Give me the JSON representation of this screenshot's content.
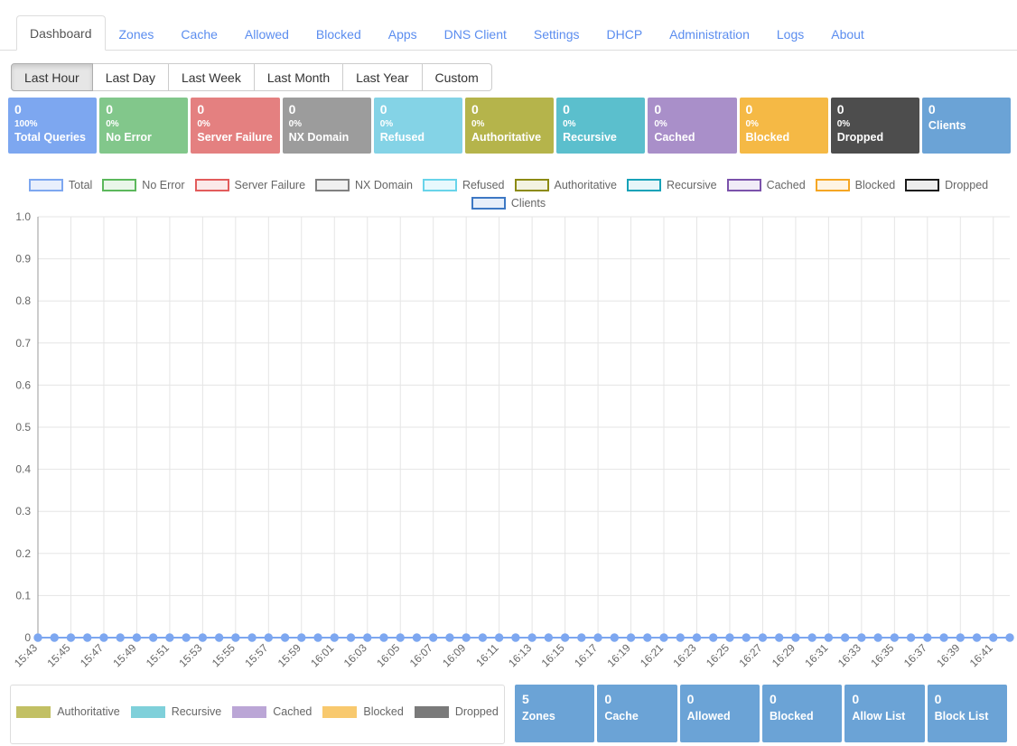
{
  "nav": {
    "tabs": [
      {
        "label": "Dashboard",
        "active": true
      },
      {
        "label": "Zones",
        "active": false
      },
      {
        "label": "Cache",
        "active": false
      },
      {
        "label": "Allowed",
        "active": false
      },
      {
        "label": "Blocked",
        "active": false
      },
      {
        "label": "Apps",
        "active": false
      },
      {
        "label": "DNS Client",
        "active": false
      },
      {
        "label": "Settings",
        "active": false
      },
      {
        "label": "DHCP",
        "active": false
      },
      {
        "label": "Administration",
        "active": false
      },
      {
        "label": "Logs",
        "active": false
      },
      {
        "label": "About",
        "active": false
      }
    ]
  },
  "range_buttons": [
    {
      "label": "Last Hour",
      "active": true
    },
    {
      "label": "Last Day",
      "active": false
    },
    {
      "label": "Last Week",
      "active": false
    },
    {
      "label": "Last Month",
      "active": false
    },
    {
      "label": "Last Year",
      "active": false
    },
    {
      "label": "Custom",
      "active": false
    }
  ],
  "stat_cards": [
    {
      "value": "0",
      "percent": "100%",
      "label": "Total Queries",
      "color": "#7da7f0"
    },
    {
      "value": "0",
      "percent": "0%",
      "label": "No Error",
      "color": "#82c78b"
    },
    {
      "value": "0",
      "percent": "0%",
      "label": "Server Failure",
      "color": "#e48080"
    },
    {
      "value": "0",
      "percent": "0%",
      "label": "NX Domain",
      "color": "#9c9c9c"
    },
    {
      "value": "0",
      "percent": "0%",
      "label": "Refused",
      "color": "#84d3e6"
    },
    {
      "value": "0",
      "percent": "0%",
      "label": "Authoritative",
      "color": "#b5b44b"
    },
    {
      "value": "0",
      "percent": "0%",
      "label": "Recursive",
      "color": "#5bbfcd"
    },
    {
      "value": "0",
      "percent": "0%",
      "label": "Cached",
      "color": "#a98fc9"
    },
    {
      "value": "0",
      "percent": "0%",
      "label": "Blocked",
      "color": "#f5b945"
    },
    {
      "value": "0",
      "percent": "0%",
      "label": "Dropped",
      "color": "#4d4d4d"
    },
    {
      "value": "0",
      "percent": "",
      "label": "Clients",
      "color": "#6ba3d6"
    }
  ],
  "bottom_legend": [
    {
      "label": "Authoritative",
      "color": "#c2c064"
    },
    {
      "label": "Recursive",
      "color": "#7fd0da"
    },
    {
      "label": "Cached",
      "color": "#bba6d6"
    },
    {
      "label": "Blocked",
      "color": "#f8c96e"
    },
    {
      "label": "Dropped",
      "color": "#7a7a7a"
    }
  ],
  "bottom_cards": [
    {
      "value": "5",
      "label": "Zones",
      "color": "#6ba3d6"
    },
    {
      "value": "0",
      "label": "Cache",
      "color": "#6ba3d6"
    },
    {
      "value": "0",
      "label": "Allowed",
      "color": "#6ba3d6"
    },
    {
      "value": "0",
      "label": "Blocked",
      "color": "#6ba3d6"
    },
    {
      "value": "0",
      "label": "Allow List",
      "color": "#6ba3d6"
    },
    {
      "value": "0",
      "label": "Block List",
      "color": "#6ba3d6"
    }
  ],
  "chart_data": {
    "type": "line",
    "title": "",
    "xlabel": "",
    "ylabel": "",
    "ylim": [
      0,
      1.0
    ],
    "y_ticks": [
      "0",
      "0.1",
      "0.2",
      "0.3",
      "0.4",
      "0.5",
      "0.6",
      "0.7",
      "0.8",
      "0.9",
      "1.0"
    ],
    "grid": true,
    "legend_position": "top",
    "x_tick_labels": [
      "15:43",
      "15:45",
      "15:47",
      "15:49",
      "15:51",
      "15:53",
      "15:55",
      "15:57",
      "15:59",
      "16:01",
      "16:03",
      "16:05",
      "16:07",
      "16:09",
      "16:11",
      "16:13",
      "16:15",
      "16:17",
      "16:19",
      "16:21",
      "16:23",
      "16:25",
      "16:27",
      "16:29",
      "16:31",
      "16:33",
      "16:35",
      "16:37",
      "16:39",
      "16:41"
    ],
    "x": [
      "15:43",
      "15:44",
      "15:45",
      "15:46",
      "15:47",
      "15:48",
      "15:49",
      "15:50",
      "15:51",
      "15:52",
      "15:53",
      "15:54",
      "15:55",
      "15:56",
      "15:57",
      "15:58",
      "15:59",
      "16:00",
      "16:01",
      "16:02",
      "16:03",
      "16:04",
      "16:05",
      "16:06",
      "16:07",
      "16:08",
      "16:09",
      "16:10",
      "16:11",
      "16:12",
      "16:13",
      "16:14",
      "16:15",
      "16:16",
      "16:17",
      "16:18",
      "16:19",
      "16:20",
      "16:21",
      "16:22",
      "16:23",
      "16:24",
      "16:25",
      "16:26",
      "16:27",
      "16:28",
      "16:29",
      "16:30",
      "16:31",
      "16:32",
      "16:33",
      "16:34",
      "16:35",
      "16:36",
      "16:37",
      "16:38",
      "16:39",
      "16:40",
      "16:41",
      "16:42"
    ],
    "series": [
      {
        "name": "Total",
        "border": "#7da7f0",
        "fill": "#e8effc",
        "visible": true,
        "values": [
          0,
          0,
          0,
          0,
          0,
          0,
          0,
          0,
          0,
          0,
          0,
          0,
          0,
          0,
          0,
          0,
          0,
          0,
          0,
          0,
          0,
          0,
          0,
          0,
          0,
          0,
          0,
          0,
          0,
          0,
          0,
          0,
          0,
          0,
          0,
          0,
          0,
          0,
          0,
          0,
          0,
          0,
          0,
          0,
          0,
          0,
          0,
          0,
          0,
          0,
          0,
          0,
          0,
          0,
          0,
          0,
          0,
          0,
          0,
          0
        ]
      },
      {
        "name": "No Error",
        "border": "#5cb85c",
        "fill": "#eaf6ea",
        "visible": false,
        "values": [
          0,
          0,
          0,
          0,
          0,
          0,
          0,
          0,
          0,
          0,
          0,
          0,
          0,
          0,
          0,
          0,
          0,
          0,
          0,
          0,
          0,
          0,
          0,
          0,
          0,
          0,
          0,
          0,
          0,
          0,
          0,
          0,
          0,
          0,
          0,
          0,
          0,
          0,
          0,
          0,
          0,
          0,
          0,
          0,
          0,
          0,
          0,
          0,
          0,
          0,
          0,
          0,
          0,
          0,
          0,
          0,
          0,
          0,
          0,
          0
        ]
      },
      {
        "name": "Server Failure",
        "border": "#e25c5c",
        "fill": "#fbeaea",
        "visible": false,
        "values": [
          0,
          0,
          0,
          0,
          0,
          0,
          0,
          0,
          0,
          0,
          0,
          0,
          0,
          0,
          0,
          0,
          0,
          0,
          0,
          0,
          0,
          0,
          0,
          0,
          0,
          0,
          0,
          0,
          0,
          0,
          0,
          0,
          0,
          0,
          0,
          0,
          0,
          0,
          0,
          0,
          0,
          0,
          0,
          0,
          0,
          0,
          0,
          0,
          0,
          0,
          0,
          0,
          0,
          0,
          0,
          0,
          0,
          0,
          0,
          0
        ]
      },
      {
        "name": "NX Domain",
        "border": "#808080",
        "fill": "#f0f0f0",
        "visible": false,
        "values": [
          0,
          0,
          0,
          0,
          0,
          0,
          0,
          0,
          0,
          0,
          0,
          0,
          0,
          0,
          0,
          0,
          0,
          0,
          0,
          0,
          0,
          0,
          0,
          0,
          0,
          0,
          0,
          0,
          0,
          0,
          0,
          0,
          0,
          0,
          0,
          0,
          0,
          0,
          0,
          0,
          0,
          0,
          0,
          0,
          0,
          0,
          0,
          0,
          0,
          0,
          0,
          0,
          0,
          0,
          0,
          0,
          0,
          0,
          0,
          0
        ]
      },
      {
        "name": "Refused",
        "border": "#68d4ea",
        "fill": "#e8f9fd",
        "visible": false,
        "values": [
          0,
          0,
          0,
          0,
          0,
          0,
          0,
          0,
          0,
          0,
          0,
          0,
          0,
          0,
          0,
          0,
          0,
          0,
          0,
          0,
          0,
          0,
          0,
          0,
          0,
          0,
          0,
          0,
          0,
          0,
          0,
          0,
          0,
          0,
          0,
          0,
          0,
          0,
          0,
          0,
          0,
          0,
          0,
          0,
          0,
          0,
          0,
          0,
          0,
          0,
          0,
          0,
          0,
          0,
          0,
          0,
          0,
          0,
          0,
          0
        ]
      },
      {
        "name": "Authoritative",
        "border": "#8c8a12",
        "fill": "#f3f3e2",
        "visible": false,
        "values": [
          0,
          0,
          0,
          0,
          0,
          0,
          0,
          0,
          0,
          0,
          0,
          0,
          0,
          0,
          0,
          0,
          0,
          0,
          0,
          0,
          0,
          0,
          0,
          0,
          0,
          0,
          0,
          0,
          0,
          0,
          0,
          0,
          0,
          0,
          0,
          0,
          0,
          0,
          0,
          0,
          0,
          0,
          0,
          0,
          0,
          0,
          0,
          0,
          0,
          0,
          0,
          0,
          0,
          0,
          0,
          0,
          0,
          0,
          0,
          0
        ]
      },
      {
        "name": "Recursive",
        "border": "#17a2b8",
        "fill": "#e6f6f9",
        "visible": false,
        "values": [
          0,
          0,
          0,
          0,
          0,
          0,
          0,
          0,
          0,
          0,
          0,
          0,
          0,
          0,
          0,
          0,
          0,
          0,
          0,
          0,
          0,
          0,
          0,
          0,
          0,
          0,
          0,
          0,
          0,
          0,
          0,
          0,
          0,
          0,
          0,
          0,
          0,
          0,
          0,
          0,
          0,
          0,
          0,
          0,
          0,
          0,
          0,
          0,
          0,
          0,
          0,
          0,
          0,
          0,
          0,
          0,
          0,
          0,
          0,
          0
        ]
      },
      {
        "name": "Cached",
        "border": "#7b52ab",
        "fill": "#f1ecf7",
        "visible": false,
        "values": [
          0,
          0,
          0,
          0,
          0,
          0,
          0,
          0,
          0,
          0,
          0,
          0,
          0,
          0,
          0,
          0,
          0,
          0,
          0,
          0,
          0,
          0,
          0,
          0,
          0,
          0,
          0,
          0,
          0,
          0,
          0,
          0,
          0,
          0,
          0,
          0,
          0,
          0,
          0,
          0,
          0,
          0,
          0,
          0,
          0,
          0,
          0,
          0,
          0,
          0,
          0,
          0,
          0,
          0,
          0,
          0,
          0,
          0,
          0,
          0
        ]
      },
      {
        "name": "Blocked",
        "border": "#f5a623",
        "fill": "#fef4e4",
        "visible": false,
        "values": [
          0,
          0,
          0,
          0,
          0,
          0,
          0,
          0,
          0,
          0,
          0,
          0,
          0,
          0,
          0,
          0,
          0,
          0,
          0,
          0,
          0,
          0,
          0,
          0,
          0,
          0,
          0,
          0,
          0,
          0,
          0,
          0,
          0,
          0,
          0,
          0,
          0,
          0,
          0,
          0,
          0,
          0,
          0,
          0,
          0,
          0,
          0,
          0,
          0,
          0,
          0,
          0,
          0,
          0,
          0,
          0,
          0,
          0,
          0,
          0
        ]
      },
      {
        "name": "Dropped",
        "border": "#1a1a1a",
        "fill": "#ededed",
        "visible": false,
        "values": [
          0,
          0,
          0,
          0,
          0,
          0,
          0,
          0,
          0,
          0,
          0,
          0,
          0,
          0,
          0,
          0,
          0,
          0,
          0,
          0,
          0,
          0,
          0,
          0,
          0,
          0,
          0,
          0,
          0,
          0,
          0,
          0,
          0,
          0,
          0,
          0,
          0,
          0,
          0,
          0,
          0,
          0,
          0,
          0,
          0,
          0,
          0,
          0,
          0,
          0,
          0,
          0,
          0,
          0,
          0,
          0,
          0,
          0,
          0,
          0
        ]
      },
      {
        "name": "Clients",
        "border": "#3d78c4",
        "fill": "#e7effa",
        "visible": false,
        "values": [
          0,
          0,
          0,
          0,
          0,
          0,
          0,
          0,
          0,
          0,
          0,
          0,
          0,
          0,
          0,
          0,
          0,
          0,
          0,
          0,
          0,
          0,
          0,
          0,
          0,
          0,
          0,
          0,
          0,
          0,
          0,
          0,
          0,
          0,
          0,
          0,
          0,
          0,
          0,
          0,
          0,
          0,
          0,
          0,
          0,
          0,
          0,
          0,
          0,
          0,
          0,
          0,
          0,
          0,
          0,
          0,
          0,
          0,
          0,
          0
        ]
      }
    ]
  },
  "doughnut_chart": {
    "type": "pie",
    "title": "",
    "categories": [
      "Authoritative",
      "Recursive",
      "Cached",
      "Blocked",
      "Dropped"
    ],
    "values": [
      0,
      0,
      0,
      0,
      0
    ],
    "colors": [
      "#c2c064",
      "#7fd0da",
      "#bba6d6",
      "#f8c96e",
      "#7a7a7a"
    ],
    "legend_position": "center"
  }
}
